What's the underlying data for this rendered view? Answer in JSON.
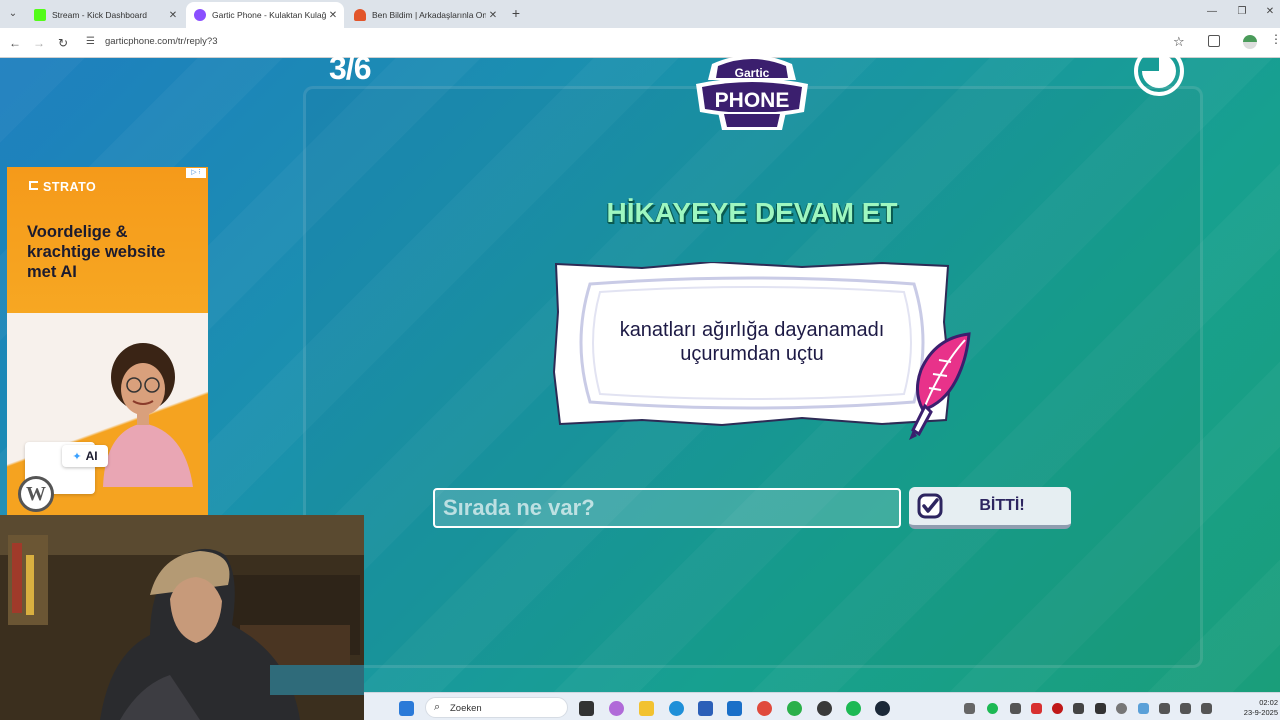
{
  "browser": {
    "tabs": [
      {
        "title": "Stream - Kick Dashboard",
        "active": false,
        "favicon_color": "#53fc18"
      },
      {
        "title": "Gartic Phone - Kulaktan Kulağa",
        "active": true,
        "favicon_color": "#8a4fff"
      },
      {
        "title": "Ben Bildim | Arkadaşlarınla Onli",
        "active": false,
        "favicon_color": "#e2552a"
      }
    ],
    "url": "garticphone.com/tr/reply?3"
  },
  "game": {
    "round": "3/6",
    "logo_top": "Gartic",
    "logo_bottom": "PHONE",
    "heading": "HİKAYEYE DEVAM ET",
    "prompt_line1": "kanatları ağırlığa dayanamadı",
    "prompt_line2": "uçurumdan uçtu",
    "input_placeholder": "Sırada ne var?",
    "done_label": "BİTTİ!",
    "timer_fraction_elapsed": 0.75
  },
  "ad": {
    "brand": "STRATO",
    "headline": "Voordelige & krachtige website met AI",
    "chip": "AI",
    "wp_glyph": "W"
  },
  "taskbar": {
    "search_placeholder": "Zoeken",
    "time": "02:02",
    "date": "23-9-2025"
  },
  "colors": {
    "accent_mint": "#9ef7c0",
    "logo_purple": "#3b1f6e",
    "feather_pink": "#e8328a"
  }
}
